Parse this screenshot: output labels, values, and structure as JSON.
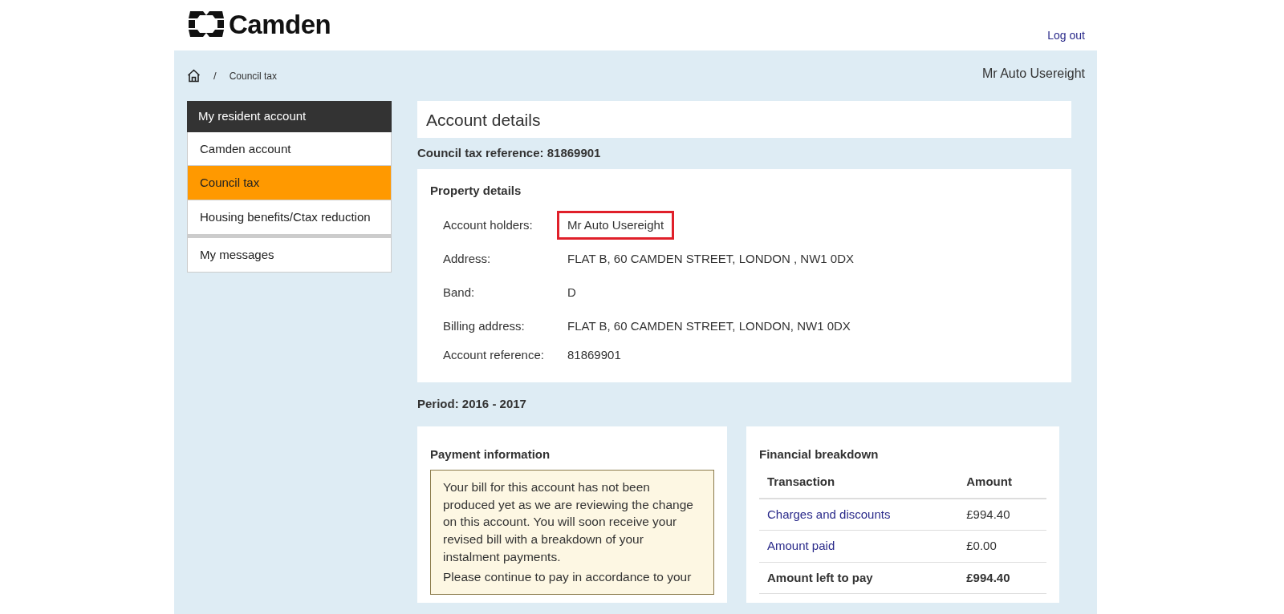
{
  "header": {
    "logo_text": "Camden",
    "logout": "Log out"
  },
  "breadcrumb": {
    "separator": "/",
    "current": "Council tax"
  },
  "user_name": "Mr Auto Usereight",
  "sidebar": {
    "title": "My resident account",
    "items": [
      {
        "label": "Camden account",
        "selected": false
      },
      {
        "label": "Council tax",
        "selected": true
      },
      {
        "label": "Housing benefits/Ctax reduction",
        "selected": false
      },
      {
        "label": "My messages",
        "selected": false
      }
    ]
  },
  "page_title": "Account details",
  "reference": "Council tax reference: 81869901",
  "property": {
    "heading": "Property details",
    "rows": [
      {
        "label": "Account holders:",
        "value": "Mr Auto Usereight",
        "highlighted": true
      },
      {
        "label": "Address:",
        "value": "FLAT B, 60 CAMDEN STREET, LONDON , NW1 0DX",
        "highlighted": false
      },
      {
        "label": "Band:",
        "value": "D",
        "highlighted": false
      },
      {
        "label": "Billing address:",
        "value": "FLAT B, 60 CAMDEN STREET, LONDON, NW1 0DX",
        "highlighted": false
      },
      {
        "label": "Account reference:",
        "value": "81869901",
        "highlighted": false
      }
    ]
  },
  "period": "Period: 2016 - 2017",
  "payment": {
    "heading": "Payment information",
    "notice": [
      "Your bill for this account has not been produced yet as we are reviewing the change on this account. You will soon receive your revised bill with a breakdown of your instalment payments.",
      "Please continue to pay in accordance to your"
    ]
  },
  "breakdown": {
    "heading": "Financial breakdown",
    "columns": [
      "Transaction",
      "Amount"
    ],
    "rows": [
      {
        "kind": "link",
        "transaction": "Charges and discounts",
        "amount": "£994.40"
      },
      {
        "kind": "link",
        "transaction": "Amount paid",
        "amount": "£0.00"
      },
      {
        "kind": "total",
        "transaction": "Amount left to pay",
        "amount": "£994.40"
      }
    ]
  }
}
